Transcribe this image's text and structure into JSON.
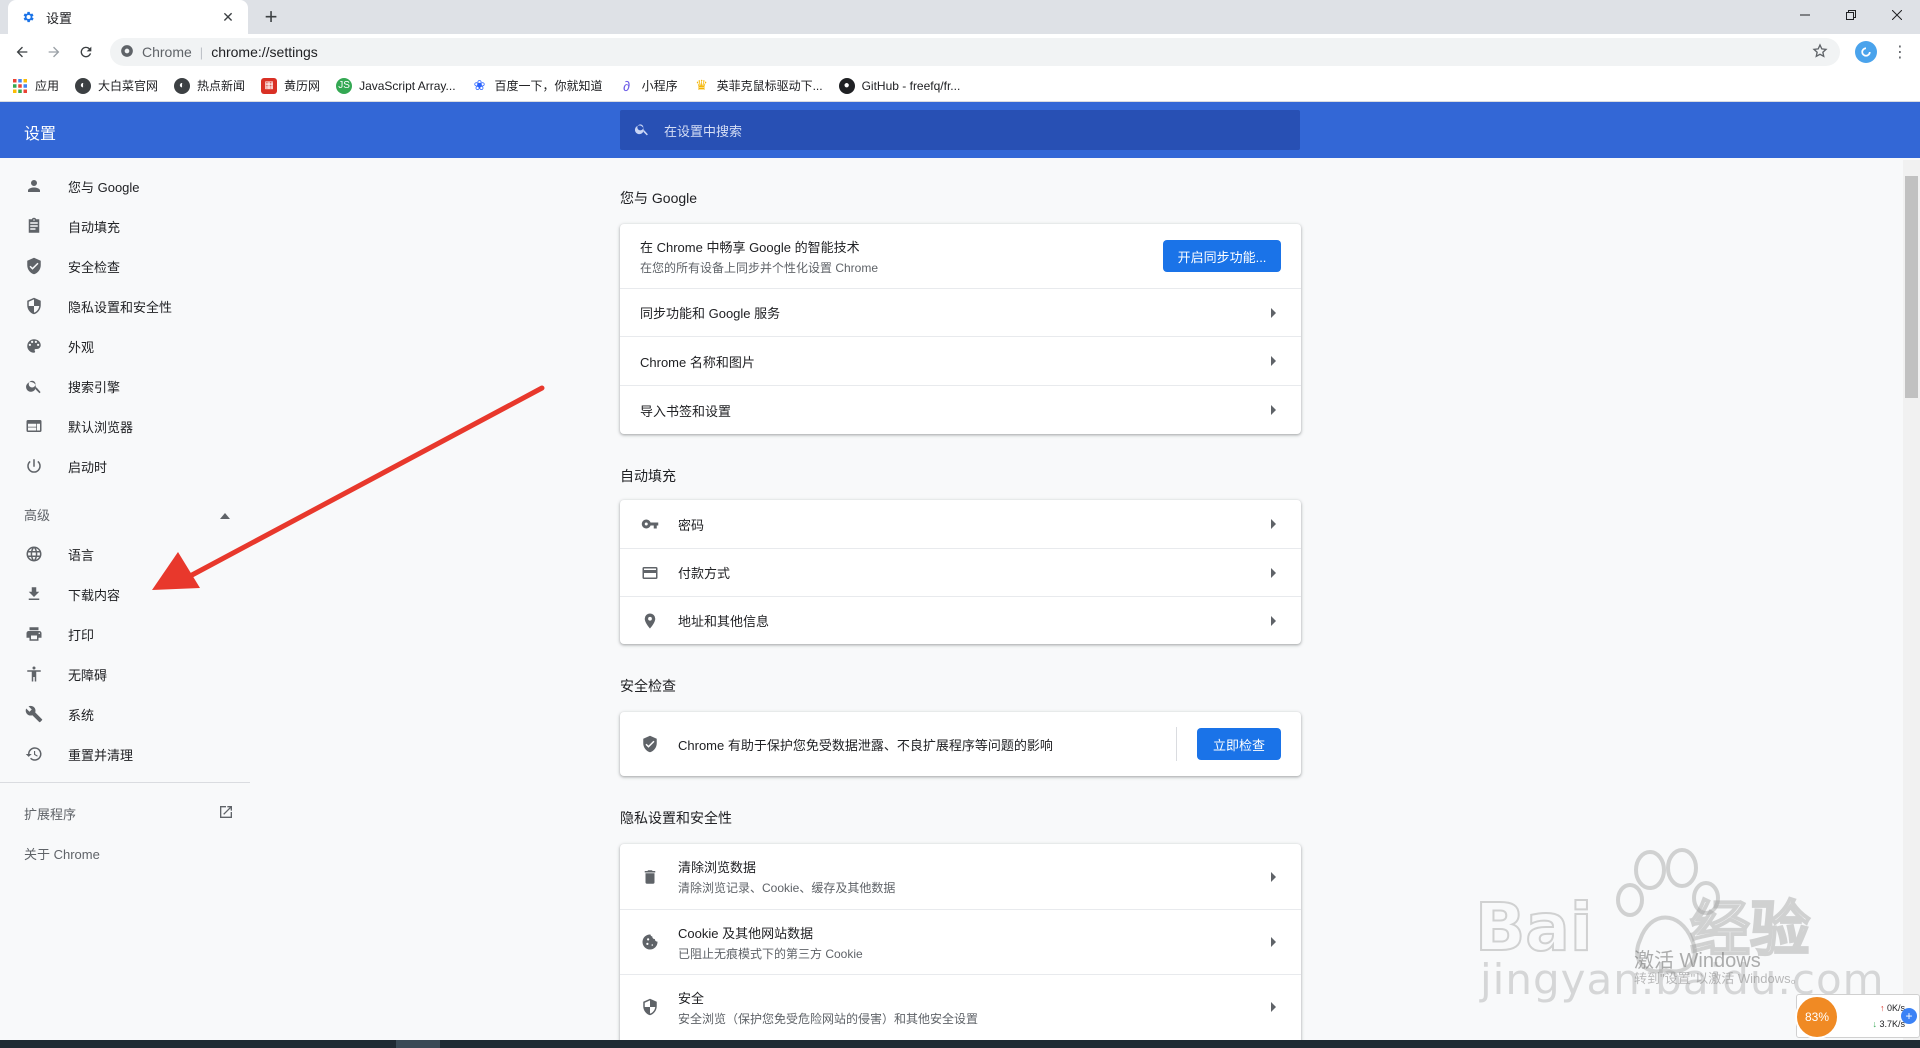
{
  "browser": {
    "tab_title": "设置",
    "omnibox_site": "Chrome",
    "omnibox_url": "chrome://settings",
    "bookmarks": [
      {
        "label": "应用",
        "icon": "apps-icon",
        "color": "#e8453c"
      },
      {
        "label": "大白菜官网",
        "icon": "globe-icon",
        "color": "#3c4043"
      },
      {
        "label": "热点新闻",
        "icon": "globe-icon",
        "color": "#3c4043"
      },
      {
        "label": "黄历网",
        "icon": "calendar-icon",
        "color": "#d93025"
      },
      {
        "label": "JavaScript Array...",
        "icon": "js-icon",
        "color": "#34a853"
      },
      {
        "label": "百度一下，你就知道",
        "icon": "baidu-paw-icon",
        "color": "#2962ff"
      },
      {
        "label": "小程序",
        "icon": "mini-program-icon",
        "color": "#6c5ce7"
      },
      {
        "label": "英菲克鼠标驱动下...",
        "icon": "trophy-icon",
        "color": "#f4b400"
      },
      {
        "label": "GitHub - freefq/fr...",
        "icon": "github-icon",
        "color": "#202124"
      }
    ]
  },
  "header": {
    "title": "设置",
    "search_placeholder": "在设置中搜索",
    "color": "#3367d6"
  },
  "sidebar": {
    "items": [
      {
        "label": "您与 Google",
        "icon": "person-icon"
      },
      {
        "label": "自动填充",
        "icon": "clipboard-icon"
      },
      {
        "label": "安全检查",
        "icon": "shield-check-icon"
      },
      {
        "label": "隐私设置和安全性",
        "icon": "shield-icon"
      },
      {
        "label": "外观",
        "icon": "palette-icon"
      },
      {
        "label": "搜索引擎",
        "icon": "search-icon"
      },
      {
        "label": "默认浏览器",
        "icon": "browser-icon"
      },
      {
        "label": "启动时",
        "icon": "power-icon"
      }
    ],
    "advanced_label": "高级",
    "advanced_items": [
      {
        "label": "语言",
        "icon": "globe-icon"
      },
      {
        "label": "下载内容",
        "icon": "download-icon"
      },
      {
        "label": "打印",
        "icon": "print-icon"
      },
      {
        "label": "无障碍",
        "icon": "accessibility-icon"
      },
      {
        "label": "系统",
        "icon": "wrench-icon"
      },
      {
        "label": "重置并清理",
        "icon": "restore-icon"
      }
    ],
    "extensions_label": "扩展程序",
    "about_label": "关于 Chrome"
  },
  "sections": {
    "you_google": {
      "title": "您与 Google",
      "sync_primary": "在 Chrome 中畅享 Google 的智能技术",
      "sync_secondary": "在您的所有设备上同步并个性化设置 Chrome",
      "sync_button": "开启同步功能...",
      "rows": [
        "同步功能和 Google 服务",
        "Chrome 名称和图片",
        "导入书签和设置"
      ]
    },
    "autofill": {
      "title": "自动填充",
      "rows": [
        {
          "label": "密码",
          "icon": "key-icon"
        },
        {
          "label": "付款方式",
          "icon": "credit-card-icon"
        },
        {
          "label": "地址和其他信息",
          "icon": "location-pin-icon"
        }
      ]
    },
    "safety": {
      "title": "安全检查",
      "text": "Chrome 有助于保护您免受数据泄露、不良扩展程序等问题的影响",
      "button": "立即检查"
    },
    "privacy": {
      "title": "隐私设置和安全性",
      "rows": [
        {
          "primary": "清除浏览数据",
          "secondary": "清除浏览记录、Cookie、缓存及其他数据",
          "icon": "trash-icon"
        },
        {
          "primary": "Cookie 及其他网站数据",
          "secondary": "已阻止无痕模式下的第三方 Cookie",
          "icon": "cookie-icon"
        },
        {
          "primary": "安全",
          "secondary": "安全浏览（保护您免受危险网站的侵害）和其他安全设置",
          "icon": "shield-icon"
        }
      ]
    }
  },
  "overlay": {
    "watermark": "jingyan.baidu.com",
    "activate_windows": "激活 Windows",
    "activate_hint": "转到\"设置\"以激活 Windows。",
    "arrow_color": "#e8382c"
  },
  "network_widget": {
    "percent": "83%",
    "up": "0K/s",
    "down": "3.7K/s"
  }
}
